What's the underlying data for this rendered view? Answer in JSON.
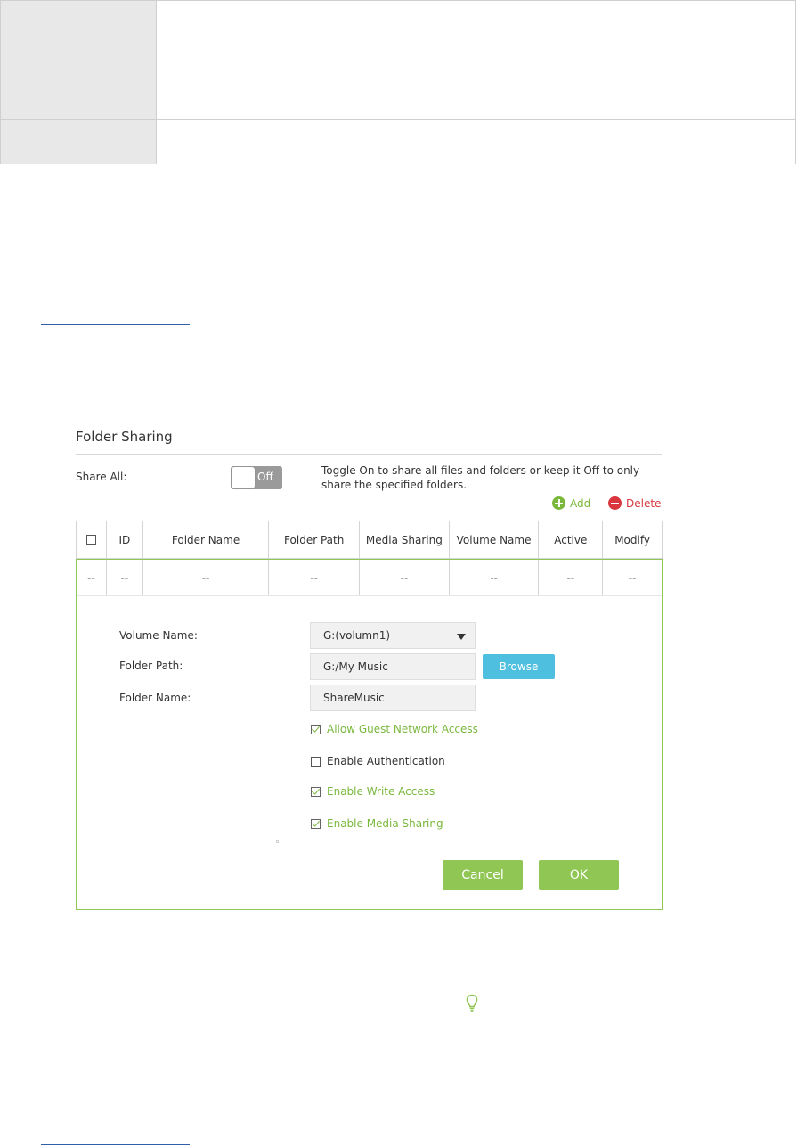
{
  "folder_sharing": {
    "title": "Folder Sharing",
    "share_all_label": "Share All:",
    "toggle_state": "Off",
    "share_all_description": "Toggle On to share all files and folders or keep it Off to only share the specified folders.",
    "add_label": "Add",
    "delete_label": "Delete"
  },
  "table": {
    "headers": [
      "ID",
      "Folder Name",
      "Folder Path",
      "Media Sharing",
      "Volume Name",
      "Active",
      "Modify"
    ],
    "row": [
      "--",
      "--",
      "--",
      "--",
      "--",
      "--",
      "--",
      "--"
    ]
  },
  "form": {
    "volume_name_label": "Volume Name:",
    "volume_name_value": "G:(volumn1)",
    "folder_path_label": "Folder Path:",
    "folder_path_value": "G:/My Music",
    "browse_label": "Browse",
    "folder_name_label": "Folder Name:",
    "folder_name_value": "ShareMusic",
    "options": [
      {
        "label": "Allow Guest Network Access",
        "checked": true
      },
      {
        "label": "Enable Authentication",
        "checked": false
      },
      {
        "label": "Enable Write Access",
        "checked": true
      },
      {
        "label": "Enable Media Sharing",
        "checked": true
      }
    ],
    "cancel_label": "Cancel",
    "ok_label": "OK"
  },
  "colors": {
    "accent_green": "#8fc654",
    "browse_blue": "#4fbfdf",
    "delete_red": "#d9363e",
    "toggle_gray": "#9a9a9a"
  },
  "icons": {
    "add": "plus-circle-icon",
    "delete": "minus-circle-icon",
    "tip": "lightbulb-icon"
  }
}
